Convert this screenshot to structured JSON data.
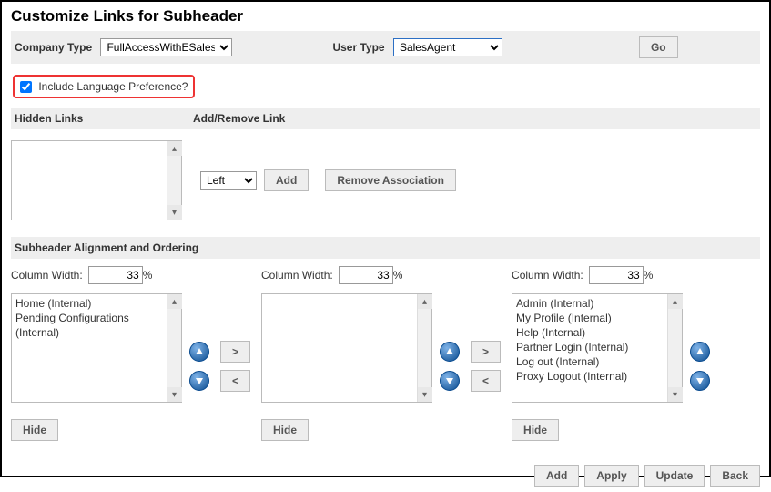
{
  "page_title": "Customize Links for Subheader",
  "top": {
    "company_label": "Company Type",
    "company_value": "FullAccessWithESales",
    "user_label": "User Type",
    "user_value": "SalesAgent",
    "go": "Go"
  },
  "checkbox": {
    "label": "Include Language Preference?",
    "checked": true
  },
  "headers": {
    "hidden": "Hidden Links",
    "addremove": "Add/Remove Link"
  },
  "addremove": {
    "position_value": "Left",
    "add": "Add",
    "remove": "Remove Association"
  },
  "alignment_header": "Subheader Alignment and Ordering",
  "colwidth_label": "Column Width:",
  "percent": "%",
  "columns": [
    {
      "width": "33",
      "items": [
        "Home (Internal)",
        "Pending Configurations (Internal)"
      ]
    },
    {
      "width": "33",
      "items": []
    },
    {
      "width": "33",
      "items": [
        "Admin (Internal)",
        "My Profile (Internal)",
        "Help (Internal)",
        "Partner Login (Internal)",
        "Log out (Internal)",
        "Proxy Logout (Internal)"
      ]
    }
  ],
  "move": {
    "right": ">",
    "left": "<"
  },
  "hide": "Hide",
  "footer": {
    "add": "Add",
    "apply": "Apply",
    "update": "Update",
    "back": "Back"
  }
}
